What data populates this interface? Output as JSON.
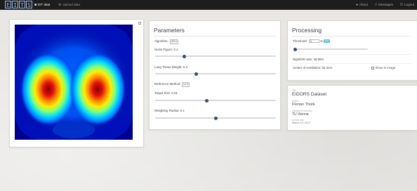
{
  "navbar": {
    "brand_letters": [
      "E",
      "I",
      "T",
      "S"
    ],
    "nav": [
      {
        "label": "EIT data",
        "icon": "folder-icon",
        "active": true
      },
      {
        "label": "Upload data",
        "icon": "plus-circle-icon",
        "active": false
      }
    ],
    "right": [
      {
        "label": "About",
        "icon": "info-icon"
      },
      {
        "label": "Messages",
        "icon": "message-icon"
      },
      {
        "label": "Logout",
        "icon": "power-icon"
      }
    ]
  },
  "parameters": {
    "title": "Parameters",
    "algorithm_label": "Algorithm:",
    "algorithm_value": "GR ▾",
    "noise_figure_label": "Noise Figure: 0.1",
    "noise_figure_fraction": 0.24,
    "lung_tissue_label": "Lung Tissue Weight: 0.2",
    "lung_tissue_fraction": 0.34,
    "reference_method_label": "Reference Method:",
    "reference_method_value": "no ▾",
    "target_size_label": "Target Size: 0.01",
    "target_size_fraction": 0.43,
    "weighting_radius_label": "Weighting Radius: 0.1",
    "weighting_radius_fraction": 0.5
  },
  "processing": {
    "title": "Processing",
    "threshold_label": "Threshold:",
    "threshold_value": "0",
    "threshold_unit": "%",
    "set_button": "Set",
    "threshold_fraction": 0.0,
    "ratio_text": "Right/left ratio: 48.86%",
    "center_text": "Center of ventilation: 53.41%",
    "show_in_image": "Show in image"
  },
  "dataset": {
    "title_label": "Title",
    "title_value": "EIDORS Dataset",
    "author_label": "Author",
    "author_value": "Florian Thürk",
    "institution_label": "Institution/Company",
    "institution_value": "TU Vienna",
    "upload_label": "Upload date",
    "upload_value": "March 10, 2017"
  },
  "colors": {
    "navbar": "#1d1d1d",
    "knob": "#3a4f73",
    "accent": "#5bc0de",
    "heat_background": "#0000a0"
  }
}
